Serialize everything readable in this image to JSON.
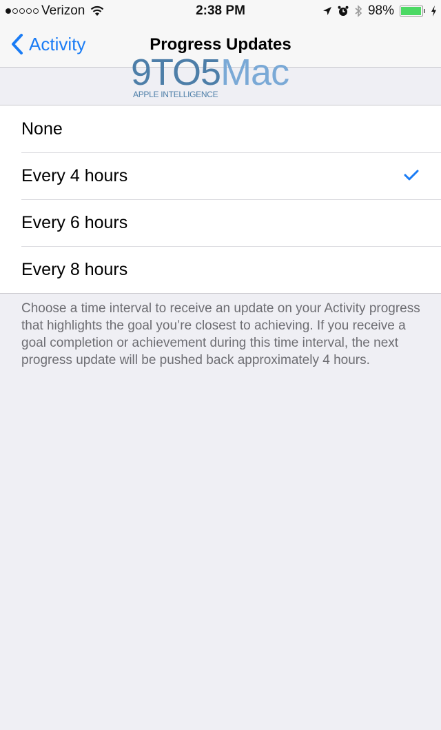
{
  "status_bar": {
    "signal_strength_dots": 1,
    "signal_total_dots": 5,
    "carrier": "Verizon",
    "time": "2:38 PM",
    "battery_percent": "98%",
    "battery_level": 0.98,
    "icons": [
      "wifi-icon",
      "location-arrow-icon",
      "alarm-icon",
      "bluetooth-icon",
      "battery-icon",
      "charging-bolt-icon"
    ]
  },
  "nav": {
    "back_label": "Activity",
    "title": "Progress Updates"
  },
  "watermark": {
    "brand_part1": "9TO5",
    "brand_part2": "Mac",
    "tagline": "APPLE INTELLIGENCE"
  },
  "options": [
    {
      "label": "None",
      "selected": false
    },
    {
      "label": "Every 4 hours",
      "selected": true
    },
    {
      "label": "Every 6 hours",
      "selected": false
    },
    {
      "label": "Every 8 hours",
      "selected": false
    }
  ],
  "footer_note": "Choose a time interval to receive an update on your Activity progress that highlights the goal you’re closest to achieving. If you receive a goal completion or achievement during this time interval, the next progress update will be pushed back approximately 4 hours.",
  "colors": {
    "accent": "#1a7cf5",
    "background": "#efeff4",
    "battery": "#4cd964"
  }
}
